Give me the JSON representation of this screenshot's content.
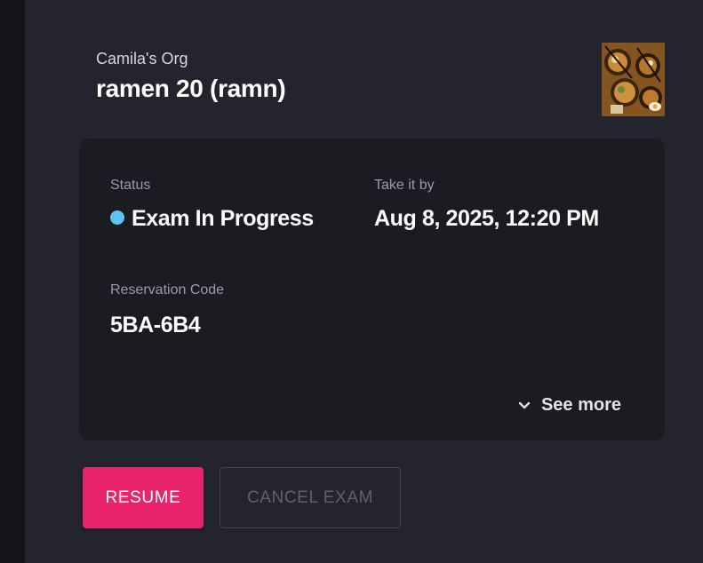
{
  "header": {
    "org_name": "Camila's Org",
    "exam_title": "ramen 20 (ramn)"
  },
  "details": {
    "status_label": "Status",
    "status_value": "Exam In Progress",
    "status_color": "#5ec4f4",
    "deadline_label": "Take it by",
    "deadline_value": "Aug 8, 2025, 12:20 PM",
    "reservation_label": "Reservation Code",
    "reservation_value": "5BA-6B4",
    "see_more_label": "See more"
  },
  "actions": {
    "resume_label": "RESUME",
    "cancel_label": "CANCEL EXAM"
  },
  "colors": {
    "accent": "#e9246d",
    "background": "#24242f",
    "card": "#1b1b21"
  },
  "icons": {
    "see_more": "chevron-down-icon",
    "thumbnail": "ramen-bowls-image"
  }
}
